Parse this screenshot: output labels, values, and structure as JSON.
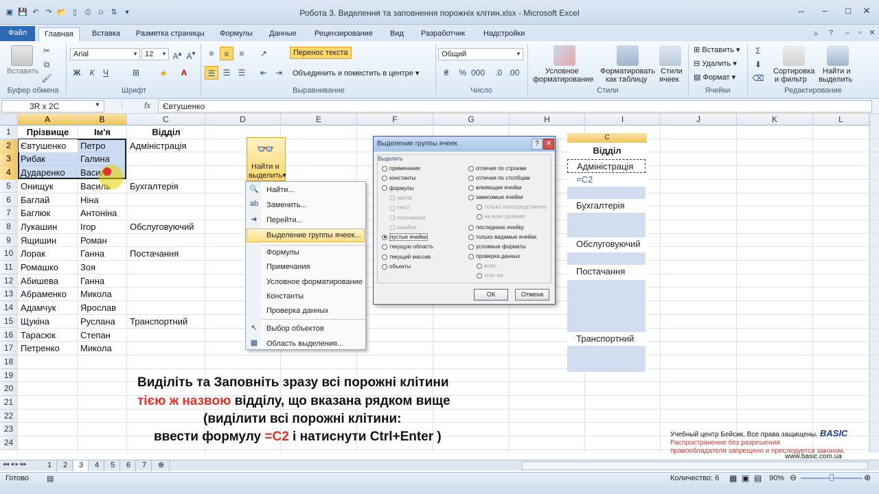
{
  "window": {
    "title": "Робота 3. Виделення та заповнення порожніх клітин.xlsx - Microsoft Excel"
  },
  "ribbon_tabs": [
    "Файл",
    "Главная",
    "Вставка",
    "Разметка страницы",
    "Формулы",
    "Данные",
    "Рецензирование",
    "Вид",
    "Разработчик",
    "Надстройки"
  ],
  "ribbon": {
    "paste": "Вставить",
    "clipboard": "Буфер обмена",
    "font_name": "Arial",
    "font_size": "12",
    "font": "Шрифт",
    "wrap_text": "Перенос текста",
    "merge_center": "Объединить и поместить в центре",
    "alignment": "Выравнивание",
    "number_format": "Общий",
    "number": "Число",
    "cond_format": "Условное",
    "cond_format2": "форматирование",
    "format_table": "Форматировать",
    "format_table2": "как таблицу",
    "cell_styles": "Стили",
    "cell_styles2": "ячеек",
    "styles": "Стили",
    "insert": "Вставить",
    "delete": "Удалить",
    "format": "Формат",
    "cells": "Ячейки",
    "sort_filter": "Сортировка",
    "sort_filter2": "и фильтр",
    "find_select": "Найти и",
    "find_select2": "выделить",
    "editing": "Редактирование"
  },
  "formula_bar": {
    "name_box": "3R x 2C",
    "fx": "fx",
    "formula": "Євтушенко"
  },
  "columns": [
    "A",
    "B",
    "C",
    "D",
    "E",
    "F",
    "G",
    "H",
    "I",
    "J",
    "K",
    "L"
  ],
  "rows": [
    "1",
    "2",
    "3",
    "4",
    "5",
    "6",
    "7",
    "8",
    "9",
    "10",
    "11",
    "12",
    "13",
    "14",
    "15",
    "16",
    "17",
    "18",
    "19",
    "20",
    "21",
    "22",
    "23",
    "24"
  ],
  "table": {
    "headers": [
      "Прізвище",
      "Ім'я",
      "Відділ"
    ],
    "data": [
      [
        "Євтушенко",
        "Петро",
        "Адміністрація"
      ],
      [
        "Рибак",
        "Галина",
        ""
      ],
      [
        "Дударенко",
        "Василь",
        ""
      ],
      [
        "Онищук",
        "Василь",
        "Бухгалтерія"
      ],
      [
        "Баглай",
        "Ніна",
        ""
      ],
      [
        "Баглюк",
        "Антоніна",
        ""
      ],
      [
        "Лукашин",
        "Ігор",
        "Обслуговуючий"
      ],
      [
        "Ящишин",
        "Роман",
        ""
      ],
      [
        "Лорак",
        "Ганна",
        "Постачання"
      ],
      [
        "Ромашко",
        "Зоя",
        ""
      ],
      [
        "Абишева",
        "Ганна",
        ""
      ],
      [
        "Абраменко",
        "Микола",
        ""
      ],
      [
        "Адамчук",
        "Ярослав",
        ""
      ],
      [
        "Щукіна",
        "Руслана",
        "Транспортний"
      ],
      [
        "Тарасюк",
        "Степан",
        ""
      ],
      [
        "Петренко",
        "Микола",
        ""
      ]
    ]
  },
  "instruction": {
    "line1": "Виділіть та Заповніть зразу всі порожні клітини",
    "line2_red": "тією ж назвою",
    "line2_rest": " відділу, що вказана рядком вище",
    "line3": "(виділити всі порожні клітини:",
    "line4_a": "ввести формулу ",
    "line4_red": "=C2",
    "line4_b": " і натиснути Ctrl+Enter )"
  },
  "find_menu": {
    "button_line1": "Найти и",
    "button_line2": "выделить",
    "items": [
      "Найти...",
      "Заменить...",
      "Перейти...",
      "Выделение группы ячеек...",
      "Формулы",
      "Примечания",
      "Условное форматирование",
      "Константы",
      "Проверка данных",
      "Выбор объектов",
      "Область выделения..."
    ]
  },
  "dialog": {
    "title": "Выделение группы ячеек",
    "group": "Выделить",
    "left_options": [
      "примечания",
      "константы",
      "формулы",
      "числа",
      "текст",
      "логические",
      "ошибки",
      "пустые ячейки",
      "текущую область",
      "текущий массив",
      "объекты"
    ],
    "right_options": [
      "отличия по строкам",
      "отличия по столбцам",
      "влияющие ячейки",
      "зависимые ячейки",
      "только непосредственно",
      "на всех уровнях",
      "последнюю ячейку",
      "только видимые ячейки",
      "условные форматы",
      "проверка данных",
      "всех",
      "этих же"
    ],
    "ok": "ОК",
    "cancel": "Отмена"
  },
  "preview": {
    "col": "C",
    "header": "Відділ",
    "values": [
      "Адміністрація",
      "=C2",
      "Бухгалтерія",
      "Обслуговуючий",
      "Постачання",
      "Транспортний"
    ]
  },
  "copyright": {
    "line1": "Учебный центр Бейсик. Все права защищены.",
    "line2": "Распространение без разрешения",
    "line3": "правообладателя запрещено и преследуется законом.",
    "url": "www.basic.com.ua",
    "logo": "BASIC"
  },
  "sheet_tabs": [
    "1",
    "2",
    "3",
    "4",
    "5",
    "6",
    "7"
  ],
  "status": {
    "ready": "Готово",
    "count": "Количество: 6",
    "zoom": "90%"
  },
  "colors": {
    "accent": "#2e69b5",
    "selection": "#f1c45a",
    "highlight_red": "#e0302a"
  }
}
